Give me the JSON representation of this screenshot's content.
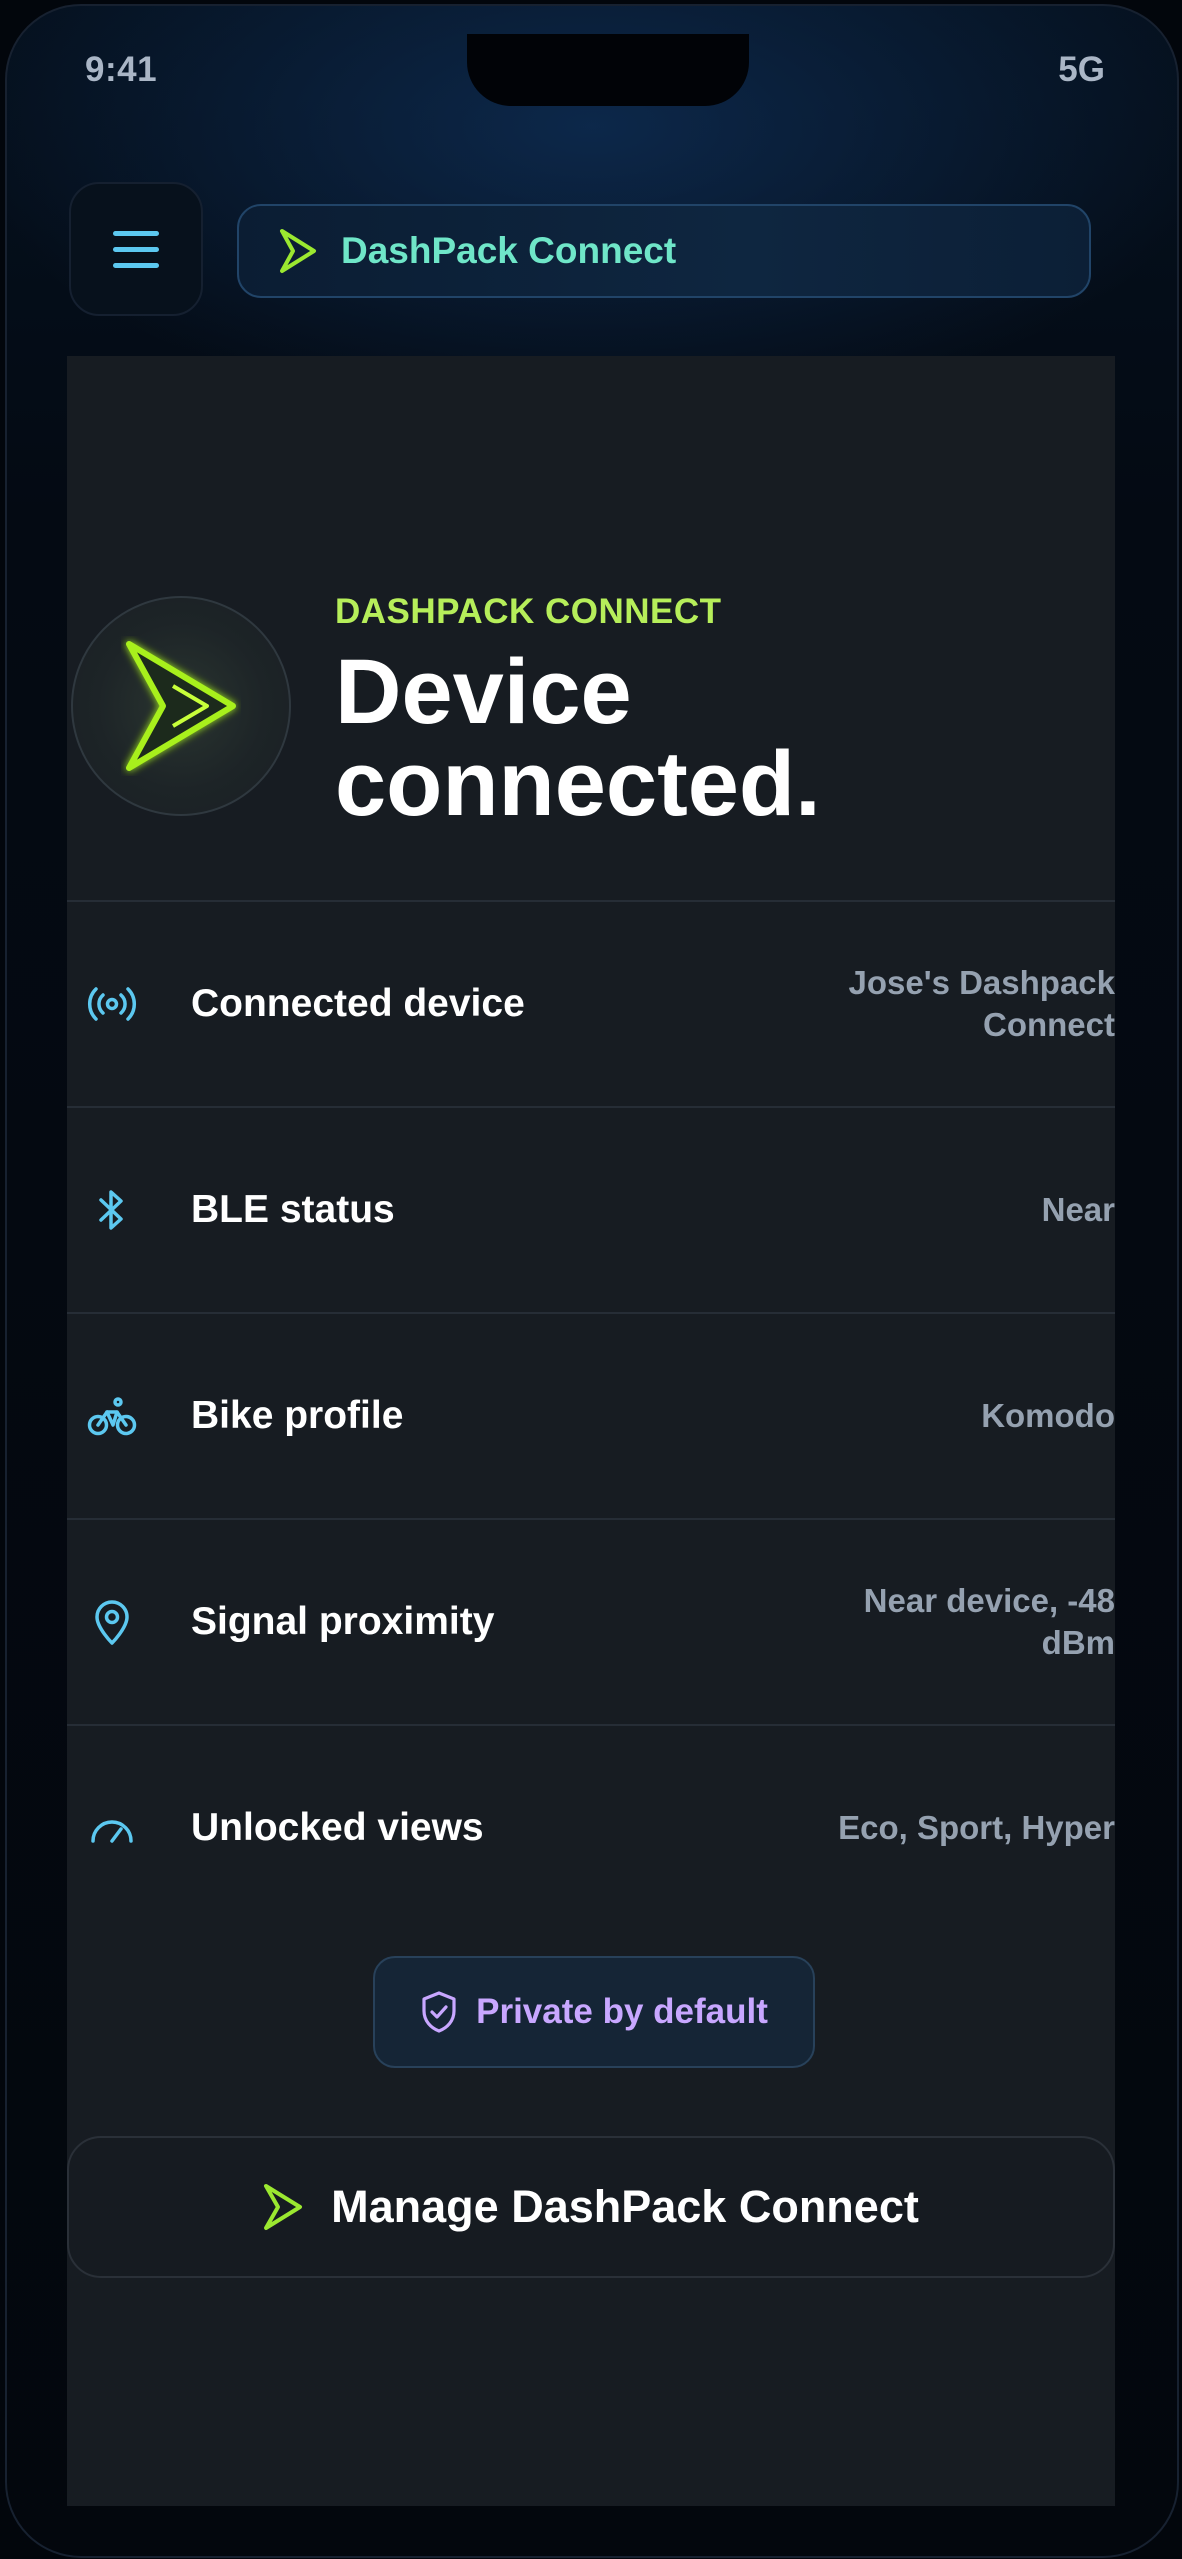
{
  "status_bar": {
    "time": "9:41",
    "network": "5G"
  },
  "header": {
    "brand_label": "DashPack Connect"
  },
  "hero": {
    "eyebrow": "DASHPACK CONNECT",
    "headline_line1": "Device",
    "headline_line2": "connected."
  },
  "details": [
    {
      "icon": "broadcast-icon",
      "label": "Connected device",
      "value_line1": "Jose's Dashpack",
      "value_line2": "Connect"
    },
    {
      "icon": "bluetooth-icon",
      "label": "BLE status",
      "value_line1": "Near"
    },
    {
      "icon": "bicycle-icon",
      "label": "Bike profile",
      "value_line1": "Komodo"
    },
    {
      "icon": "location-pin-icon",
      "label": "Signal proximity",
      "value_line1": "Near device, -48 dBm"
    },
    {
      "icon": "speedometer-icon",
      "label": "Unlocked views",
      "value_line1": "Eco, Sport, Hyper"
    }
  ],
  "privacy_badge": {
    "label": "Private by default"
  },
  "manage_button": {
    "label": "Manage DashPack Connect"
  },
  "colors": {
    "accent_green": "#b6ee5a",
    "accent_teal": "#6fe6c8",
    "icon_blue": "#5cc8f0",
    "privacy_purple": "#c8a7ff",
    "card_bg": "#171c22"
  }
}
